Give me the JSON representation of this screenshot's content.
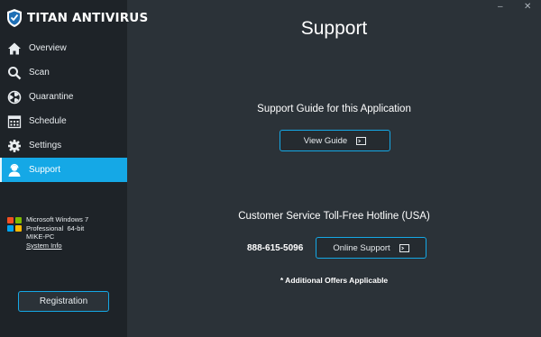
{
  "app": {
    "brand": "TITAN ANTIVIRUS",
    "accent": "#15a8e6"
  },
  "window_controls": {
    "minimize": "–",
    "close": "✕"
  },
  "sidebar": {
    "items": [
      {
        "label": "Overview",
        "icon": "home-icon"
      },
      {
        "label": "Scan",
        "icon": "search-icon"
      },
      {
        "label": "Quarantine",
        "icon": "biohazard-icon"
      },
      {
        "label": "Schedule",
        "icon": "calendar-icon"
      },
      {
        "label": "Settings",
        "icon": "gear-icon"
      },
      {
        "label": "Support",
        "icon": "user-support-icon",
        "active": true
      }
    ],
    "system": {
      "os": "Microsoft Windows 7",
      "edition": "Professional  64-bit",
      "machine": "MIKE-PC",
      "info_link": "System Info"
    },
    "registration_label": "Registration"
  },
  "main": {
    "title": "Support",
    "guide_heading": "Support Guide for this Application",
    "view_guide_label": "View Guide",
    "hotline_heading": "Customer Service Toll-Free Hotline (USA)",
    "phone": "888-615-5096",
    "online_support_label": "Online Support",
    "note": "* Additional Offers Applicable"
  }
}
